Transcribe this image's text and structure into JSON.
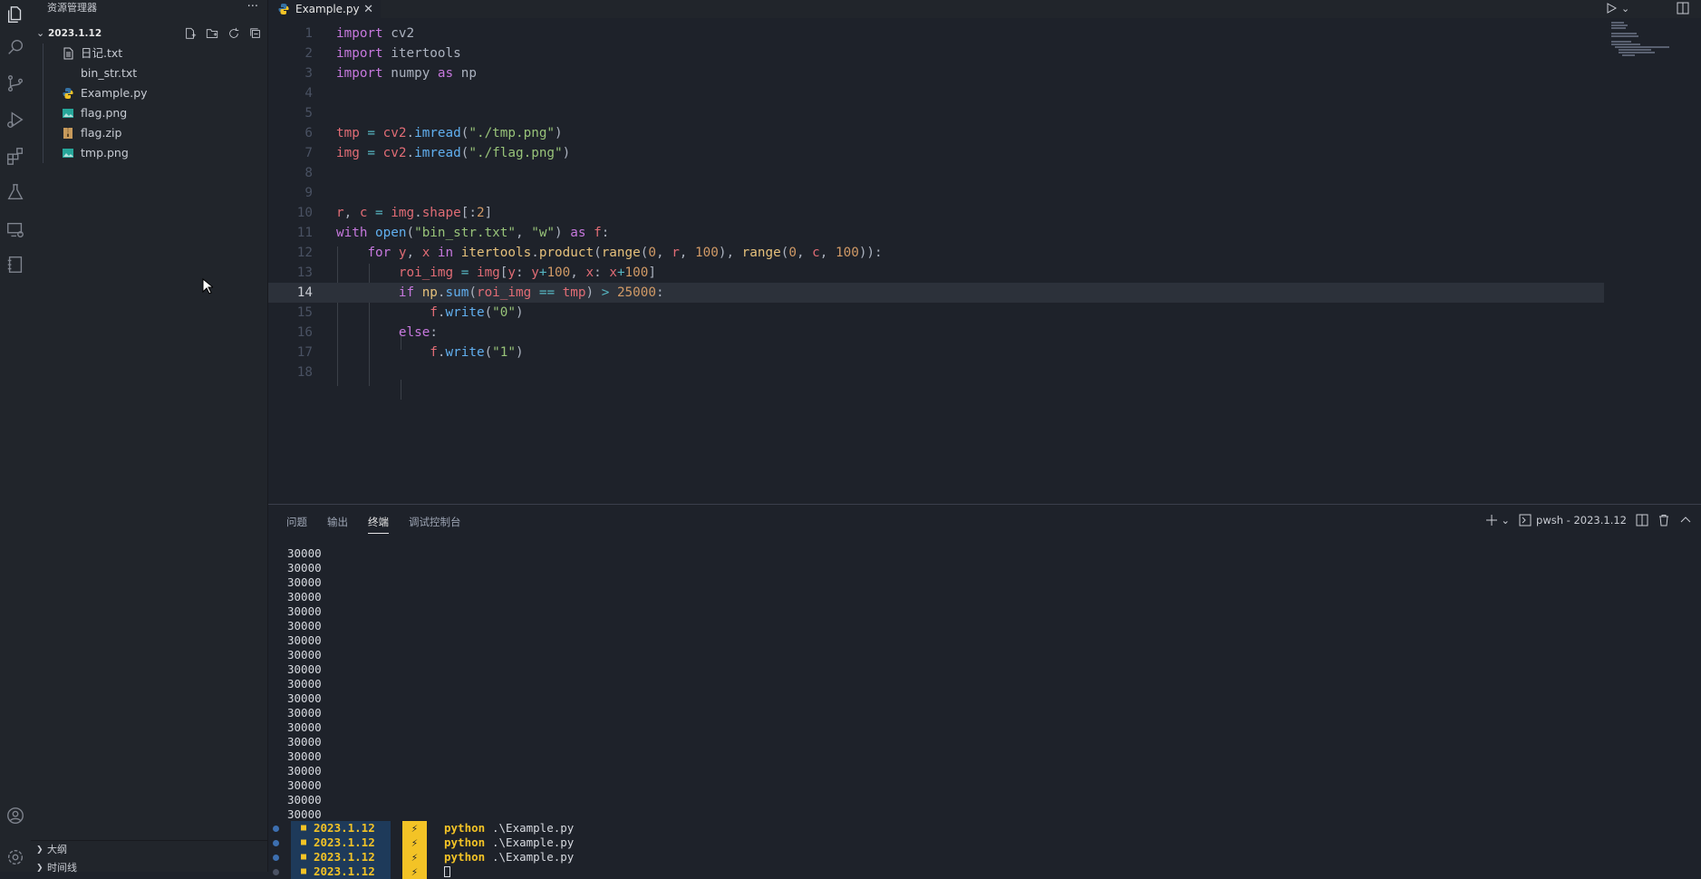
{
  "sidebar": {
    "title": "资源管理器",
    "more": "···",
    "folder": "2023.1.12",
    "files": [
      {
        "name": "日记.txt",
        "icon": "text-file-icon"
      },
      {
        "name": "bin_str.txt",
        "icon": "text-file-icon"
      },
      {
        "name": "Example.py",
        "icon": "python-file-icon"
      },
      {
        "name": "flag.png",
        "icon": "image-file-icon"
      },
      {
        "name": "flag.zip",
        "icon": "zip-file-icon"
      },
      {
        "name": "tmp.png",
        "icon": "image-file-icon"
      }
    ],
    "outline": "大纲",
    "timeline": "时间线"
  },
  "editor": {
    "tab": "Example.py",
    "tab_close": "✕",
    "current_line": 14,
    "line_numbers": [
      "1",
      "2",
      "3",
      "4",
      "5",
      "6",
      "7",
      "8",
      "9",
      "10",
      "11",
      "12",
      "13",
      "14",
      "15",
      "16",
      "17",
      "18"
    ],
    "code": {
      "l1": [
        "import",
        " cv2"
      ],
      "l2": [
        "import",
        " itertools"
      ],
      "l3": [
        "import",
        " numpy ",
        "as",
        " np"
      ],
      "l6": [
        "tmp",
        " = ",
        "cv2",
        ".",
        "imread",
        "(",
        "\"./tmp.png\"",
        ")"
      ],
      "l7": [
        "img",
        " = ",
        "cv2",
        ".",
        "imread",
        "(",
        "\"./flag.png\"",
        ")"
      ],
      "l10": [
        "r",
        ", ",
        "c",
        " = ",
        "img",
        ".",
        "shape",
        "[:",
        "2",
        "]"
      ],
      "l11": [
        "with",
        " ",
        "open",
        "(",
        "\"bin_str.txt\"",
        ", ",
        "\"w\"",
        ") ",
        "as",
        " ",
        "f",
        ":"
      ],
      "l12": [
        "    ",
        "for",
        " ",
        "y",
        ", ",
        "x",
        " ",
        "in",
        " ",
        "itertools",
        ".",
        "product",
        "(",
        "range",
        "(",
        "0",
        ", ",
        "r",
        ", ",
        "100",
        "), ",
        "range",
        "(",
        "0",
        ", ",
        "c",
        ", ",
        "100",
        ")):"
      ],
      "l13": [
        "        ",
        "roi_img",
        " = ",
        "img",
        "[",
        "y",
        ": ",
        "y",
        "+",
        "100",
        ", ",
        "x",
        ": ",
        "x",
        "+",
        "100",
        "]"
      ],
      "l14": [
        "        ",
        "if",
        " ",
        "np",
        ".",
        "sum",
        "(",
        "roi_img",
        " == ",
        "tmp",
        ") ",
        ">",
        " ",
        "25000",
        ":"
      ],
      "l15": [
        "            ",
        "f",
        ".",
        "write",
        "(",
        "\"0\"",
        ")"
      ],
      "l16": [
        "        ",
        "else",
        ":"
      ],
      "l17": [
        "            ",
        "f",
        ".",
        "write",
        "(",
        "\"1\"",
        ")"
      ]
    }
  },
  "panel": {
    "tabs": [
      "问题",
      "输出",
      "终端",
      "调试控制台"
    ],
    "active_tab": "终端",
    "terminal_name": "pwsh - 2023.1.12",
    "output_lines": [
      "30000",
      "30000",
      "30000",
      "30000",
      "30000",
      "30000",
      "30000",
      "30000",
      "30000",
      "30000",
      "30000",
      "30000",
      "30000",
      "30000",
      "30000",
      "30000",
      "30000",
      "30000",
      "30000"
    ],
    "prompts": [
      {
        "dir": "2023.1.12",
        "cmd": "python",
        "arg": ".\\Example.py"
      },
      {
        "dir": "2023.1.12",
        "cmd": "python",
        "arg": ".\\Example.py"
      },
      {
        "dir": "2023.1.12",
        "cmd": "python",
        "arg": ".\\Example.py"
      },
      {
        "dir": "2023.1.12",
        "cmd": "",
        "arg": ""
      }
    ]
  },
  "colors": {
    "keyword": "#c678dd",
    "variable": "#e06c75",
    "function": "#61afef",
    "string": "#98c379",
    "number": "#d19a66",
    "prompt_yellow": "#f3c326"
  }
}
